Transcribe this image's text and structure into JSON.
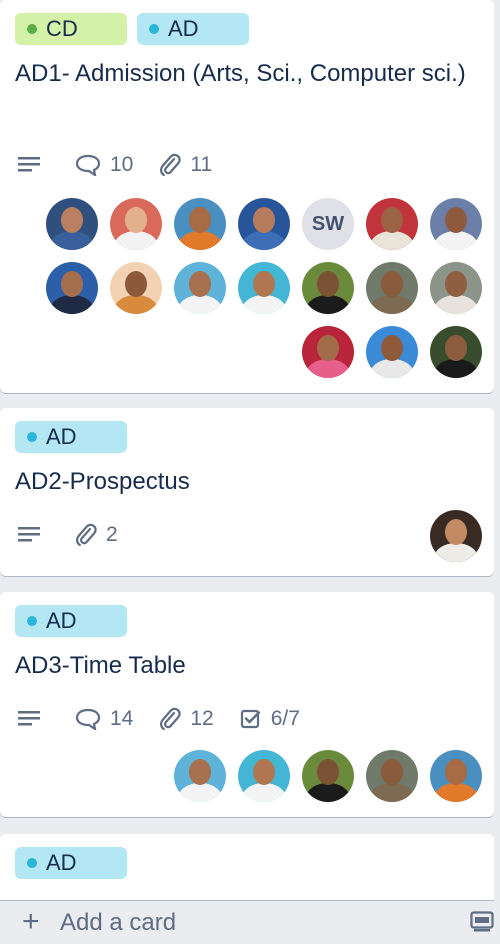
{
  "cards": [
    {
      "labels": [
        {
          "text": "CD",
          "color": "#5aac44"
        },
        {
          "text": "AD",
          "color": "#29b6d9"
        }
      ],
      "title": "AD1- Admission (Arts, Sci., Computer sci.)",
      "has_description": true,
      "comments": "10",
      "attachments": "11",
      "members": [
        {
          "type": "photo",
          "bg": "#2f4f7f",
          "face": "#b98062",
          "body": "#3b5f9c"
        },
        {
          "type": "photo",
          "bg": "#d96a5b",
          "face": "#e2b08c",
          "body": "#f2f2f2"
        },
        {
          "type": "photo",
          "bg": "#4a8fc0",
          "face": "#a86b45",
          "body": "#e07a2a"
        },
        {
          "type": "photo",
          "bg": "#28549a",
          "face": "#b67b5b",
          "body": "#3e6fb6"
        },
        {
          "type": "initials",
          "text": "SW"
        },
        {
          "type": "photo",
          "bg": "#c2343c",
          "face": "#9b6446",
          "body": "#e9e4d8"
        },
        {
          "type": "photo",
          "bg": "#6b7fa8",
          "face": "#8e5a3e",
          "body": "#f3f3f3"
        },
        {
          "type": "photo",
          "bg": "#2d5fa8",
          "face": "#a56f4e",
          "body": "#1f2a44"
        },
        {
          "type": "photo",
          "bg": "#f2d2b3",
          "face": "#8c5a3a",
          "body": "#d88b3c"
        },
        {
          "type": "photo",
          "bg": "#5fb3d9",
          "face": "#a7714f",
          "body": "#f4f4f4"
        },
        {
          "type": "photo",
          "bg": "#44b6d6",
          "face": "#b17752",
          "body": "#f4f4f4"
        },
        {
          "type": "photo",
          "bg": "#6a8a3c",
          "face": "#7c5236",
          "body": "#1b1b1b"
        },
        {
          "type": "photo",
          "bg": "#6f7a6a",
          "face": "#8a5b3d",
          "body": "#7e6a52"
        },
        {
          "type": "photo",
          "bg": "#8a9488",
          "face": "#8f5f43",
          "body": "#e7e2dc"
        },
        {
          "type": "photo",
          "bg": "#b8243a",
          "face": "#a26b4a",
          "body": "#e65f8b"
        },
        {
          "type": "photo",
          "bg": "#3a8ad8",
          "face": "#8e5a3a",
          "body": "#e8e8e8"
        },
        {
          "type": "photo",
          "bg": "#3a4c2e",
          "face": "#8c5c3e",
          "body": "#1a1a1a"
        }
      ]
    },
    {
      "labels": [
        {
          "text": "AD",
          "color": "#29b6d9"
        }
      ],
      "title": "AD2-Prospectus",
      "has_description": true,
      "attachments": "2",
      "members": [
        {
          "type": "photo",
          "bg": "#3a2a24",
          "face": "#c28a63",
          "body": "#ecebe6"
        }
      ]
    },
    {
      "labels": [
        {
          "text": "AD",
          "color": "#29b6d9"
        }
      ],
      "title": "AD3-Time Table",
      "has_description": true,
      "comments": "14",
      "attachments": "12",
      "checklist": "6/7",
      "members": [
        {
          "type": "photo",
          "bg": "#5fb3d9",
          "face": "#a7714f",
          "body": "#f4f4f4"
        },
        {
          "type": "photo",
          "bg": "#44b6d6",
          "face": "#b17752",
          "body": "#f4f4f4"
        },
        {
          "type": "photo",
          "bg": "#6a8a3c",
          "face": "#7c5236",
          "body": "#1b1b1b"
        },
        {
          "type": "photo",
          "bg": "#6f7a6a",
          "face": "#8a5b3d",
          "body": "#7e6a52"
        },
        {
          "type": "photo",
          "bg": "#4a8fc0",
          "face": "#a86b45",
          "body": "#e07a2a"
        }
      ]
    },
    {
      "labels": [
        {
          "text": "AD",
          "color": "#29b6d9"
        }
      ]
    }
  ],
  "add_card_label": "Add a card"
}
